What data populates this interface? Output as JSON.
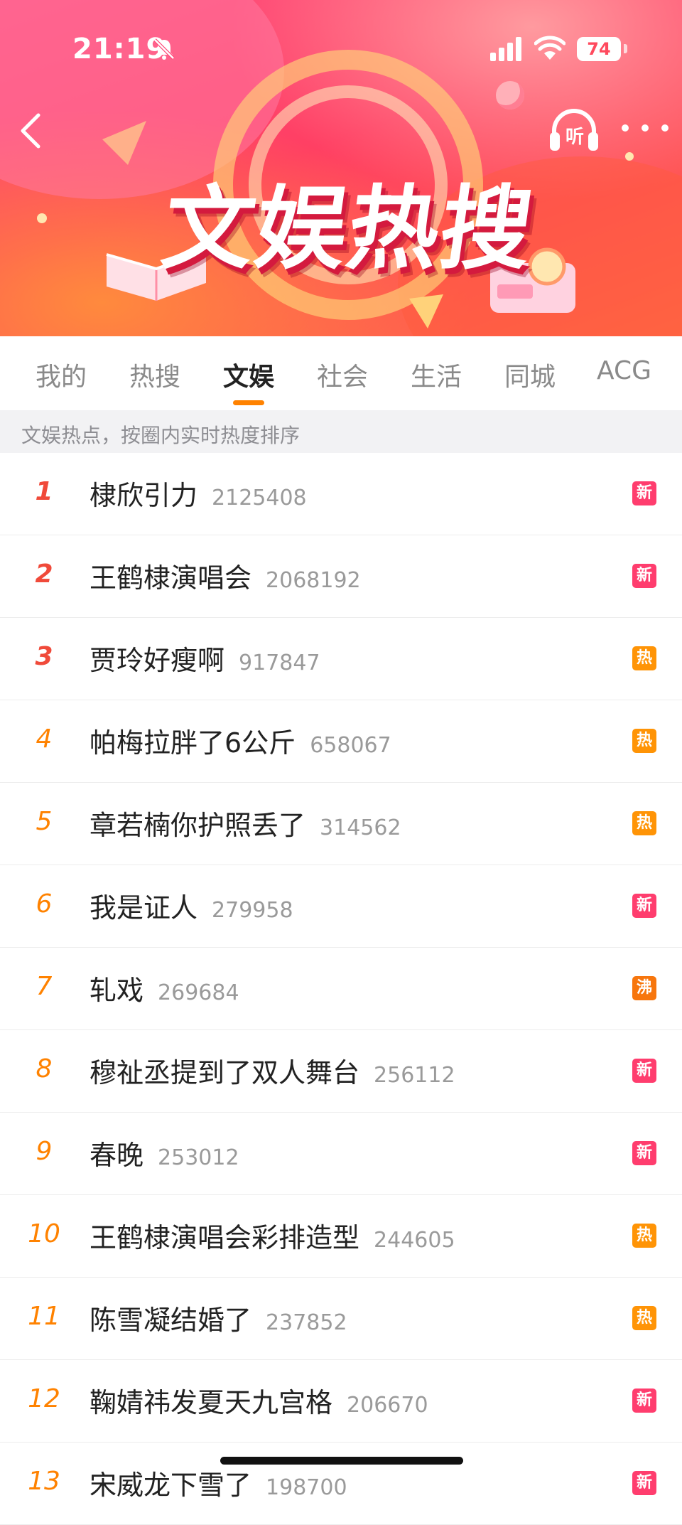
{
  "status_bar": {
    "time": "21:19",
    "battery": "74"
  },
  "header": {
    "banner_title": "文娱热搜",
    "listen_label": "听"
  },
  "tabs": [
    {
      "label": "我的"
    },
    {
      "label": "热搜"
    },
    {
      "label": "文娱",
      "active": true
    },
    {
      "label": "社会"
    },
    {
      "label": "生活"
    },
    {
      "label": "同城"
    },
    {
      "label": "ACG"
    }
  ],
  "hint": "文娱热点，按圈内实时热度排序",
  "colors": {
    "accent_orange": "#ff8200",
    "rank_top": "#f04a3a",
    "badge_new": "#ff3d6e",
    "badge_hot": "#ff9406",
    "badge_boil": "#f7760d"
  },
  "items": [
    {
      "rank": "1",
      "title": "棣欣引力",
      "count": "2125408",
      "badge": "新",
      "badge_type": "new"
    },
    {
      "rank": "2",
      "title": "王鹤棣演唱会",
      "count": "2068192",
      "badge": "新",
      "badge_type": "new"
    },
    {
      "rank": "3",
      "title": "贾玲好瘦啊",
      "count": "917847",
      "badge": "热",
      "badge_type": "hot"
    },
    {
      "rank": "4",
      "title": "帕梅拉胖了6公斤",
      "count": "658067",
      "badge": "热",
      "badge_type": "hot"
    },
    {
      "rank": "5",
      "title": "章若楠你护照丢了",
      "count": "314562",
      "badge": "热",
      "badge_type": "hot"
    },
    {
      "rank": "6",
      "title": "我是证人",
      "count": "279958",
      "badge": "新",
      "badge_type": "new"
    },
    {
      "rank": "7",
      "title": "轧戏",
      "count": "269684",
      "badge": "沸",
      "badge_type": "boil"
    },
    {
      "rank": "8",
      "title": "穆祉丞提到了双人舞台",
      "count": "256112",
      "badge": "新",
      "badge_type": "new"
    },
    {
      "rank": "9",
      "title": "春晚",
      "count": "253012",
      "badge": "新",
      "badge_type": "new"
    },
    {
      "rank": "10",
      "title": "王鹤棣演唱会彩排造型",
      "count": "244605",
      "badge": "热",
      "badge_type": "hot"
    },
    {
      "rank": "11",
      "title": "陈雪凝结婚了",
      "count": "237852",
      "badge": "热",
      "badge_type": "hot"
    },
    {
      "rank": "12",
      "title": "鞠婧祎发夏天九宫格",
      "count": "206670",
      "badge": "新",
      "badge_type": "new"
    },
    {
      "rank": "13",
      "title": "宋威龙下雪了",
      "count": "198700",
      "badge": "新",
      "badge_type": "new"
    }
  ]
}
